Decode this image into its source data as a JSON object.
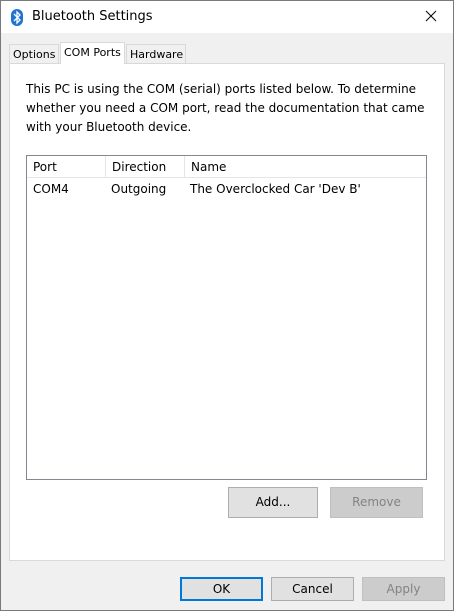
{
  "window": {
    "title": "Bluetooth Settings"
  },
  "tabs": [
    {
      "label": "Options"
    },
    {
      "label": "COM Ports"
    },
    {
      "label": "Hardware"
    }
  ],
  "panel": {
    "description": "This PC is using the COM (serial) ports listed below. To determine whether you need a COM port, read the documentation that came with your Bluetooth device.",
    "columns": [
      "Port",
      "Direction",
      "Name"
    ],
    "rows": [
      {
        "port": "COM4",
        "direction": "Outgoing",
        "name": "The Overclocked Car 'Dev B'"
      }
    ],
    "add_label": "Add...",
    "remove_label": "Remove"
  },
  "footer": {
    "ok_label": "OK",
    "cancel_label": "Cancel",
    "apply_label": "Apply"
  },
  "colors": {
    "accent": "#0078d7",
    "bluetooth": "#1e74d0"
  }
}
